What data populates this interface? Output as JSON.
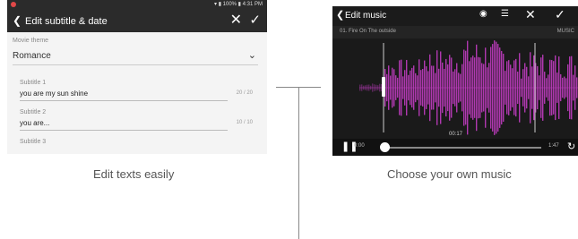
{
  "left_screen": {
    "title": "Edit subtitle & date",
    "theme_label": "Movie theme",
    "theme_value": "Romance",
    "subtitles": [
      {
        "label": "Subtitle 1",
        "value": "you are my sun shine",
        "count": "20 / 20"
      },
      {
        "label": "Subtitle 2",
        "value": "you are...",
        "count": "10 / 10"
      },
      {
        "label": "Subtitle 3",
        "value": "",
        "count": ""
      }
    ]
  },
  "right_screen": {
    "title": "Edit music",
    "track_name": "01. Fire On The outside",
    "source_label": "MUSIC",
    "selection_time": "00:17",
    "time_start": "0:00",
    "time_end": "1:47",
    "waveform_color": "#c03cc0"
  },
  "captions": {
    "left": "Edit texts easily",
    "right": "Choose your own music"
  }
}
